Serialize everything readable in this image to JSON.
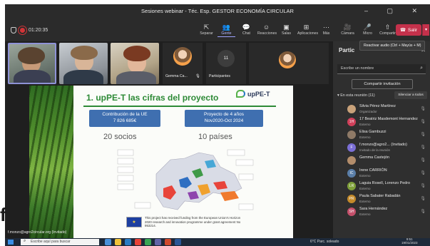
{
  "window": {
    "title": "Sesiones webinar - Téc. Esp. GESTOR ECONOMÍA CIRCULAR",
    "controls": "– ▢ ✕"
  },
  "meeting": {
    "timer": "01:20:35"
  },
  "toolbar": {
    "tools": [
      {
        "label": "Separar",
        "icon": "⇱"
      },
      {
        "label": "Gente",
        "icon": "👥",
        "active": true
      },
      {
        "label": "Chat",
        "icon": "💬"
      },
      {
        "label": "Reacciones",
        "icon": "☺"
      },
      {
        "label": "Salas",
        "icon": "▣"
      },
      {
        "label": "Aplicaciones",
        "icon": "⊞"
      },
      {
        "label": "Más",
        "icon": "⋯"
      }
    ],
    "tools2": [
      {
        "label": "Cámara",
        "icon": "🎥"
      },
      {
        "label": "Micro",
        "icon": "🎤"
      },
      {
        "label": "Compartir",
        "icon": "⇧"
      }
    ],
    "leave_label": "Salir",
    "tooltip": "Reactivar audio (Ctrl + Mayús + M)"
  },
  "tiles": {
    "gemma_label": "Gemma Ca...",
    "participants_count": "11",
    "participants_label": "Participantes"
  },
  "slide": {
    "title": "1. upPE-T las cifras del proyecto",
    "logo_text": "upPE-T",
    "box1": "Contribución de la UE\n7 826 685€",
    "box2": "Proyecto de 4 años\nNov2020-Oct 2024",
    "kpi1": "20 socios",
    "kpi2": "10 países",
    "eu_flag": "★",
    "funding": "This project has received funding from the European Union's Horizon 2020 research and innovation programme under grant agreement No 953214."
  },
  "presenter_label": "f.monzo@agro2circular.org (Invitado)",
  "panel": {
    "title": "Partic",
    "close": "✕",
    "search_placeholder": "Escribe un nombre",
    "share_invitation": "Compartir invitación",
    "section": "▾ En esta reunión (11)",
    "mute_all": "Silenciar a todos",
    "participants": [
      {
        "name": "Silvia Pérez Martínez",
        "role": "Organizador",
        "initials": "",
        "color": "#c9a27a"
      },
      {
        "name": "17 Beatriz Masdemont Hernandez",
        "role": "Externo",
        "initials": "1H",
        "color": "#d0405a"
      },
      {
        "name": "Elisa Gambuzzi",
        "role": "Externo",
        "initials": "",
        "color": "#8f7a67"
      },
      {
        "name": "f.monzo@agro2... (Invitado)",
        "role": "Invitado de la reunión",
        "initials": "F",
        "color": "#7b6fd6"
      },
      {
        "name": "Gemma Castejón",
        "role": "",
        "initials": "",
        "color": "#b38d6b"
      },
      {
        "name": "Irene CARRIÓN",
        "role": "Externo",
        "initials": "IC",
        "color": "#5a7ea8"
      },
      {
        "name": "Laguia Rosell, Lorenzo Pedro",
        "role": "Externo",
        "initials": "LR",
        "color": "#7fa03a"
      },
      {
        "name": "Paula Sabater Rabadán",
        "role": "Externo",
        "initials": "PR",
        "color": "#c48a2a"
      },
      {
        "name": "Sara Hernández",
        "role": "Externo",
        "initials": "SH",
        "color": "#c4506a"
      }
    ]
  },
  "taskbar": {
    "search_placeholder": "Escribe aquí para buscar",
    "weather": "6°C  Parc. soleado",
    "time": "9:51",
    "date": "19/01/2023"
  },
  "watermark": "f"
}
